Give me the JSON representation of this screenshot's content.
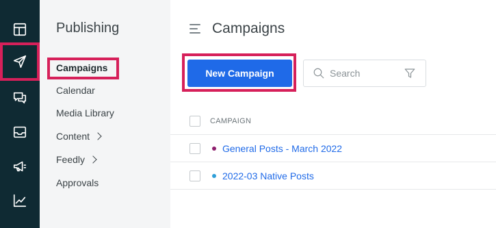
{
  "rail": {
    "items": [
      {
        "icon": "layout-dashboard-icon",
        "active": false
      },
      {
        "icon": "send-icon",
        "active": true
      },
      {
        "icon": "chat-bubbles-icon",
        "active": false
      },
      {
        "icon": "inbox-icon",
        "active": false
      },
      {
        "icon": "megaphone-icon",
        "active": false
      },
      {
        "icon": "analytics-chart-icon",
        "active": false
      }
    ],
    "background": "#0f2a33"
  },
  "subnav": {
    "title": "Publishing",
    "items": [
      {
        "label": "Campaigns",
        "active": true,
        "has_submenu": false
      },
      {
        "label": "Calendar",
        "active": false,
        "has_submenu": false
      },
      {
        "label": "Media Library",
        "active": false,
        "has_submenu": false
      },
      {
        "label": "Content",
        "active": false,
        "has_submenu": true
      },
      {
        "label": "Feedly",
        "active": false,
        "has_submenu": true
      },
      {
        "label": "Approvals",
        "active": false,
        "has_submenu": false
      }
    ]
  },
  "main": {
    "title": "Campaigns",
    "new_button_label": "New Campaign",
    "search": {
      "placeholder": "Search",
      "value": ""
    },
    "table": {
      "column_header": "CAMPAIGN",
      "rows": [
        {
          "name": "General Posts - March 2022",
          "color": "#8e1f6e"
        },
        {
          "name": "2022-03 Native Posts",
          "color": "#2f9fd8"
        }
      ]
    }
  },
  "colors": {
    "accent": "#1f6ae8",
    "highlight": "#d6205a"
  }
}
